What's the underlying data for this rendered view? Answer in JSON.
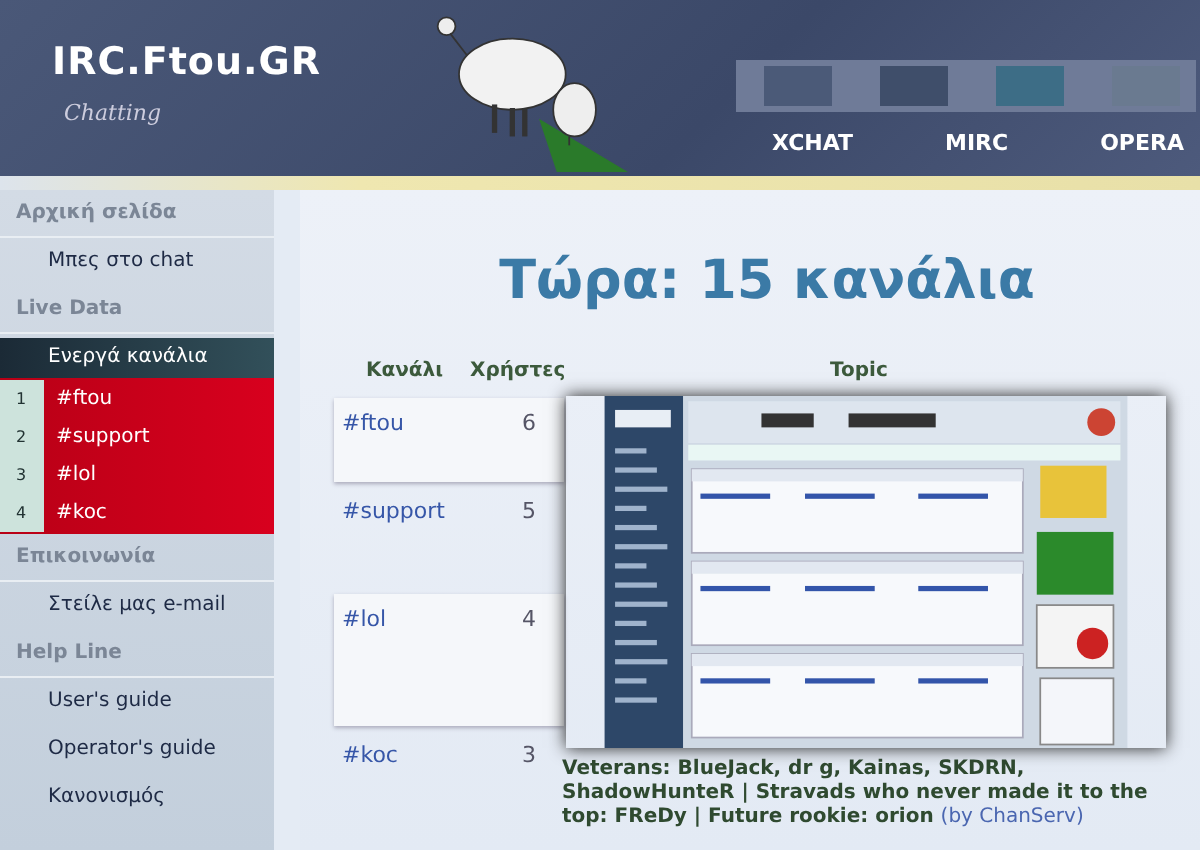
{
  "header": {
    "logo": "IRC.Ftou.GR",
    "tagline": "Chatting",
    "nav": [
      {
        "label": "XCHAT"
      },
      {
        "label": "MIRC"
      },
      {
        "label": "OPERA"
      }
    ]
  },
  "sidebar": {
    "items": [
      {
        "kind": "section",
        "label": "Αρχική σελίδα"
      },
      {
        "kind": "link",
        "label": "Μπες στο chat"
      },
      {
        "kind": "section",
        "label": "Live Data"
      },
      {
        "kind": "active",
        "label": "Ενεργά κανάλια",
        "children": [
          {
            "number": "1",
            "label": "#ftou"
          },
          {
            "number": "2",
            "label": "#support"
          },
          {
            "number": "3",
            "label": "#lol"
          },
          {
            "number": "4",
            "label": "#koc"
          }
        ]
      },
      {
        "kind": "section",
        "label": "Επικοινωνία"
      },
      {
        "kind": "link",
        "label": "Στείλε μας e-mail"
      },
      {
        "kind": "section",
        "label": "Help Line"
      },
      {
        "kind": "link",
        "label": "User's guide"
      },
      {
        "kind": "link",
        "label": "Operator's guide"
      },
      {
        "kind": "link",
        "label": "Κανονισμός"
      }
    ]
  },
  "main": {
    "title": "Τώρα: 15 κανάλια",
    "table": {
      "columns": [
        "Κανάλι",
        "Χρήστες",
        "Topic"
      ],
      "rows": [
        {
          "channel": "#ftou",
          "users": "6",
          "boxed": true
        },
        {
          "channel": "#support",
          "users": "5",
          "boxed": false
        },
        {
          "channel": "#lol",
          "users": "4",
          "boxed": true
        },
        {
          "channel": "#koc",
          "users": "3",
          "boxed": false,
          "topic": "Veterans: BlueJack, dr g, Kainas, SKDRN, ShadowHunteR | Stravads who never made it to the top: FReDy | Future rookie: orion",
          "topic_by": "(by ChanServ)"
        }
      ]
    }
  }
}
